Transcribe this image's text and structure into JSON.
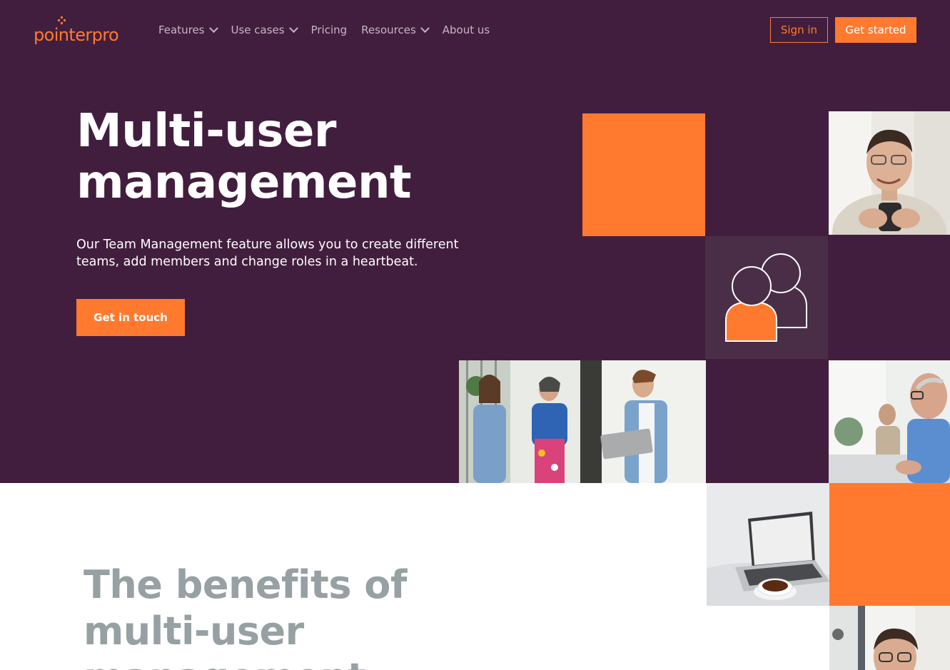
{
  "brand": {
    "name": "pointerpro",
    "color": "#ff7a2f"
  },
  "nav": {
    "items": [
      {
        "label": "Features",
        "dropdown": true
      },
      {
        "label": "Use cases",
        "dropdown": true
      },
      {
        "label": "Pricing",
        "dropdown": false
      },
      {
        "label": "Resources",
        "dropdown": true
      },
      {
        "label": "About us",
        "dropdown": false
      }
    ],
    "sign_in": "Sign in",
    "get_started": "Get started"
  },
  "hero": {
    "title": "Multi-user management",
    "description": "Our Team Management feature allows you to create different teams, add members and change roles in a heartbeat.",
    "cta": "Get in touch",
    "background": "#421e3e"
  },
  "benefits": {
    "title": "The benefits of multi-user management"
  },
  "colors": {
    "accent": "#ff7a2f",
    "hero_bg": "#421e3e",
    "muted_heading": "#97a0a2",
    "nav_text": "#c4b5c2"
  }
}
